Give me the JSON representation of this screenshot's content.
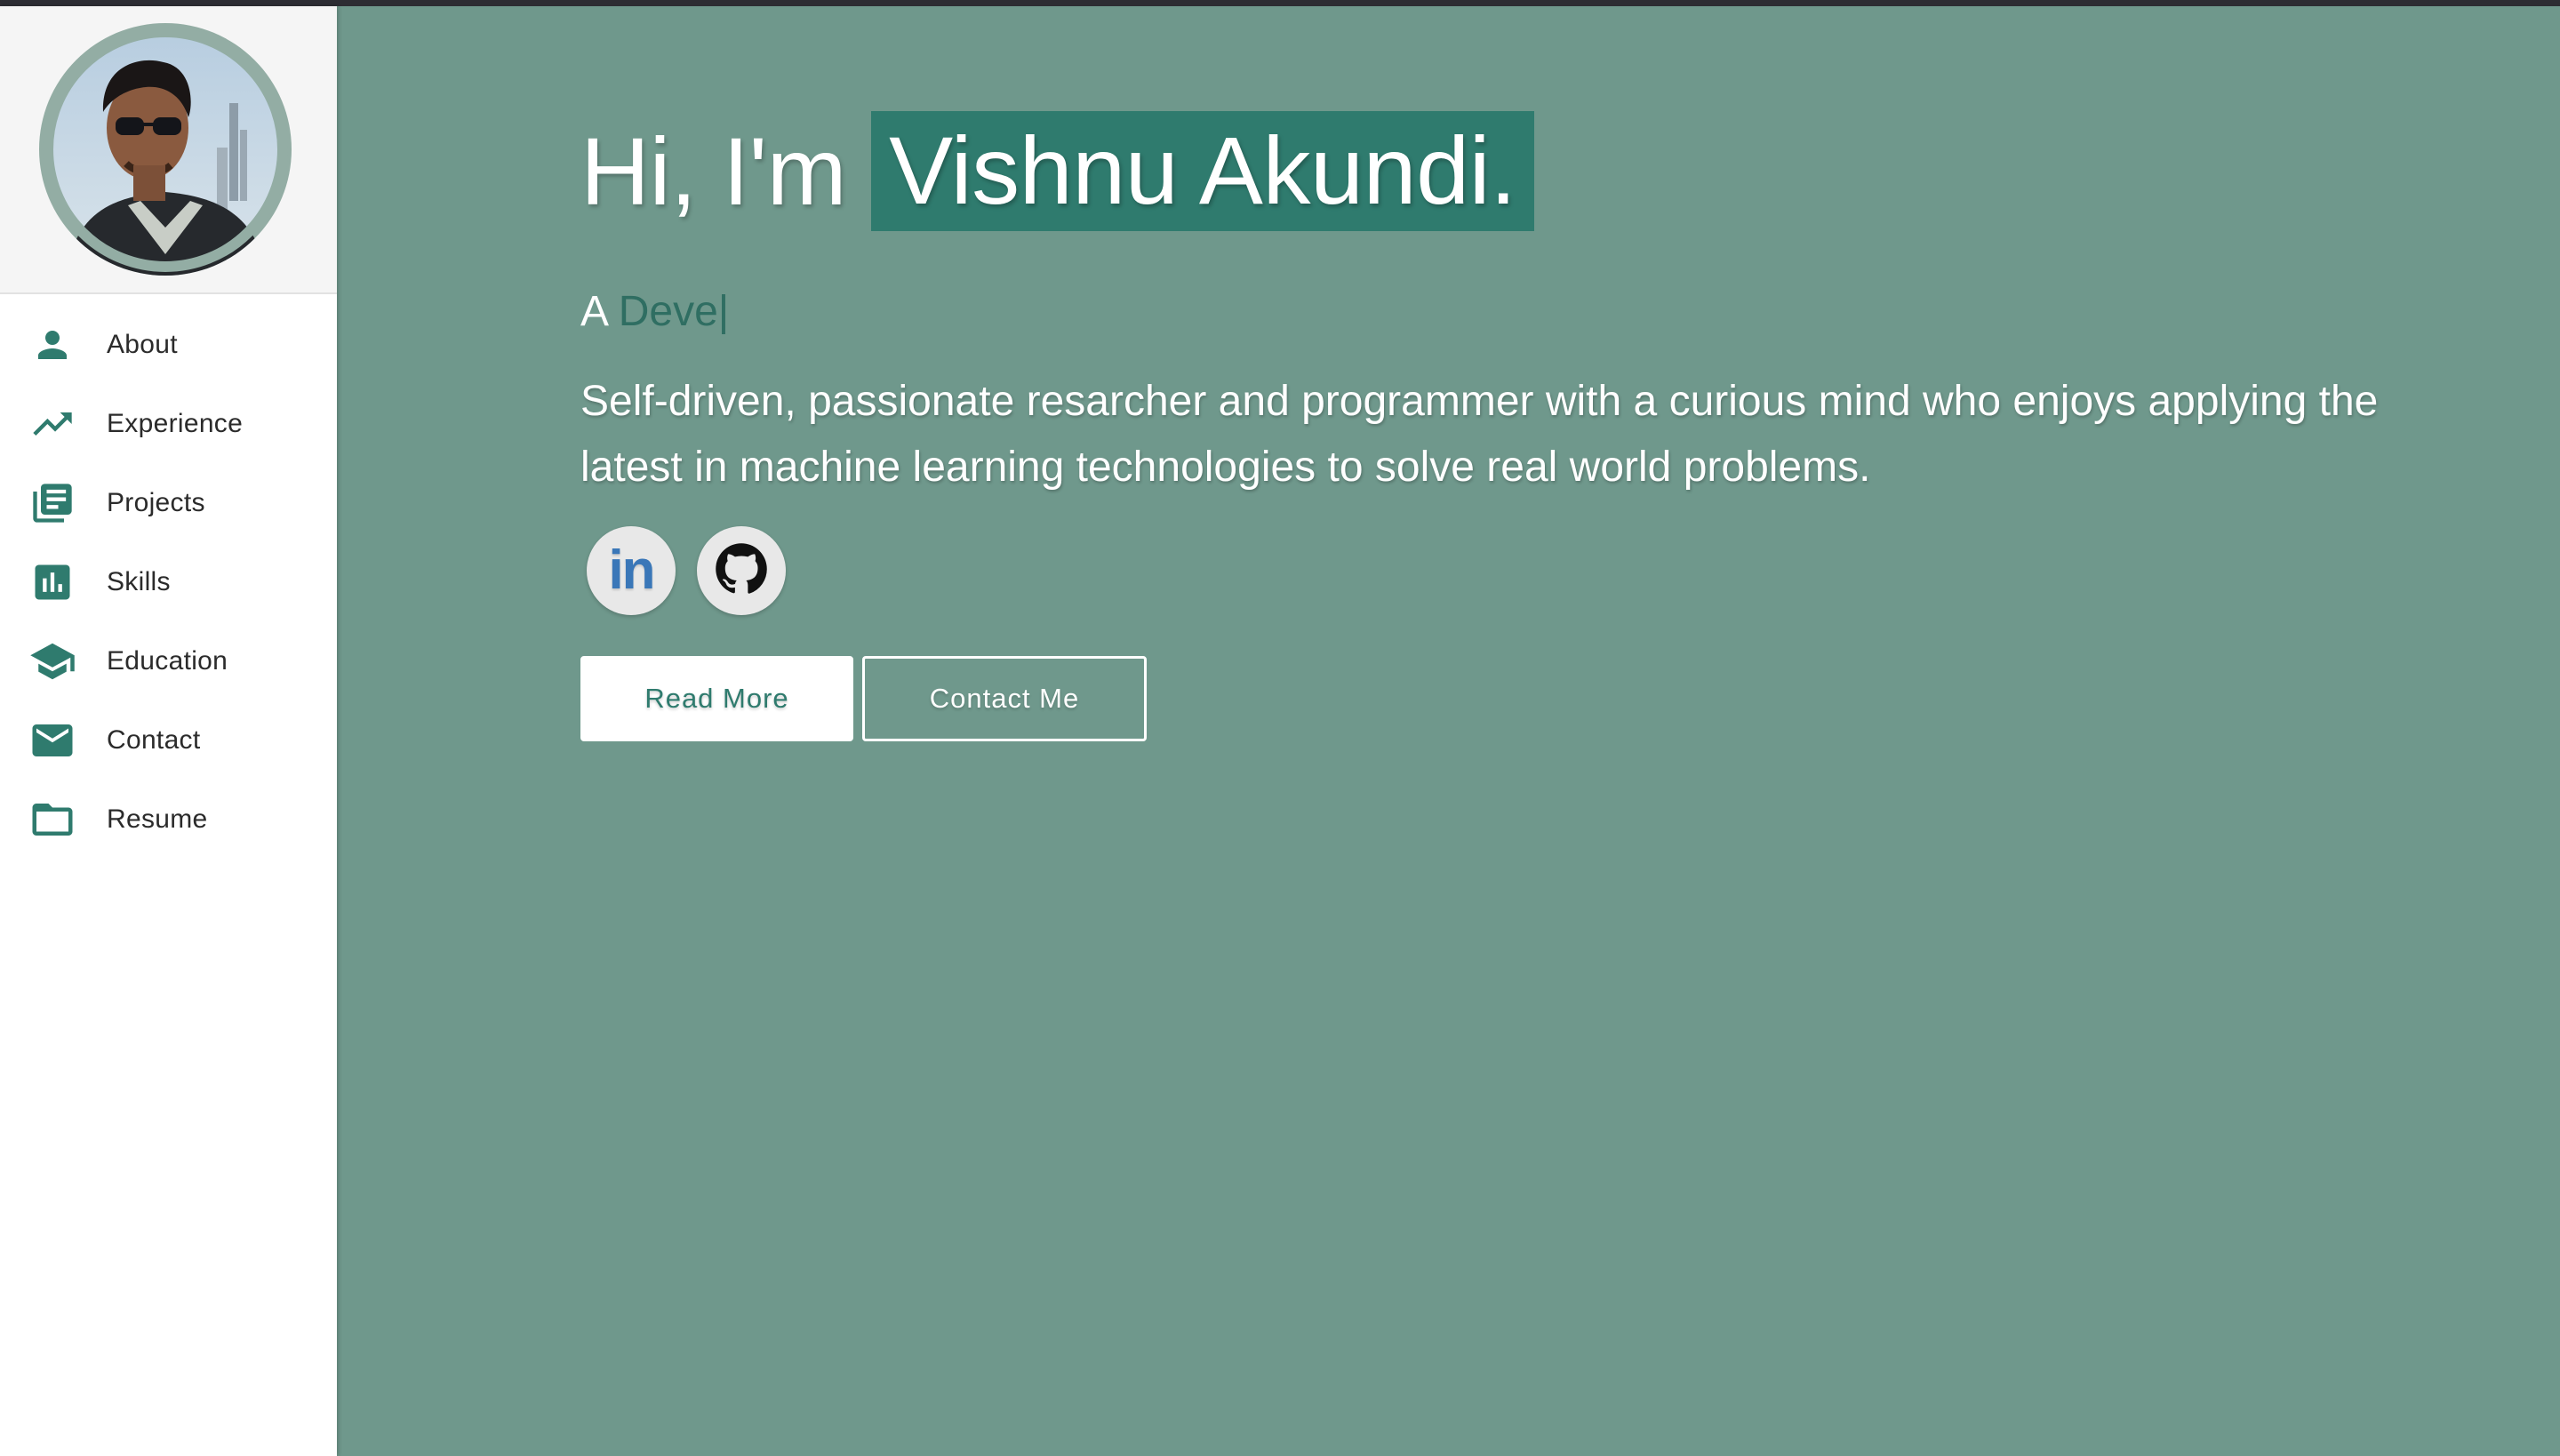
{
  "colors": {
    "accent": "#2f7b6e",
    "main_background": "#6f988c",
    "sidebar_background": "#ffffff",
    "nav_icon": "#2f7b6e"
  },
  "sidebar": {
    "avatar_icon": "profile-photo",
    "items": [
      {
        "label": "About",
        "icon": "person-icon"
      },
      {
        "label": "Experience",
        "icon": "trending-up-icon"
      },
      {
        "label": "Projects",
        "icon": "library-books-icon"
      },
      {
        "label": "Skills",
        "icon": "bar-chart-icon"
      },
      {
        "label": "Education",
        "icon": "school-icon"
      },
      {
        "label": "Contact",
        "icon": "email-icon"
      },
      {
        "label": "Resume",
        "icon": "folder-icon"
      }
    ]
  },
  "hero": {
    "greeting": "Hi, I'm",
    "name": "Vishnu Akundi.",
    "subtitle_prefix": "A",
    "subtitle_typed": "Deve",
    "subtitle_cursor": "|",
    "description": "Self-driven, passionate resarcher and programmer with a curious mind who enjoys applying the latest in machine learning technologies to solve real world problems."
  },
  "social": {
    "linkedin_text": "in",
    "linkedin_icon": "linkedin-icon",
    "github_icon": "github-icon"
  },
  "actions": {
    "read_more_label": "Read More",
    "contact_label": "Contact Me"
  }
}
